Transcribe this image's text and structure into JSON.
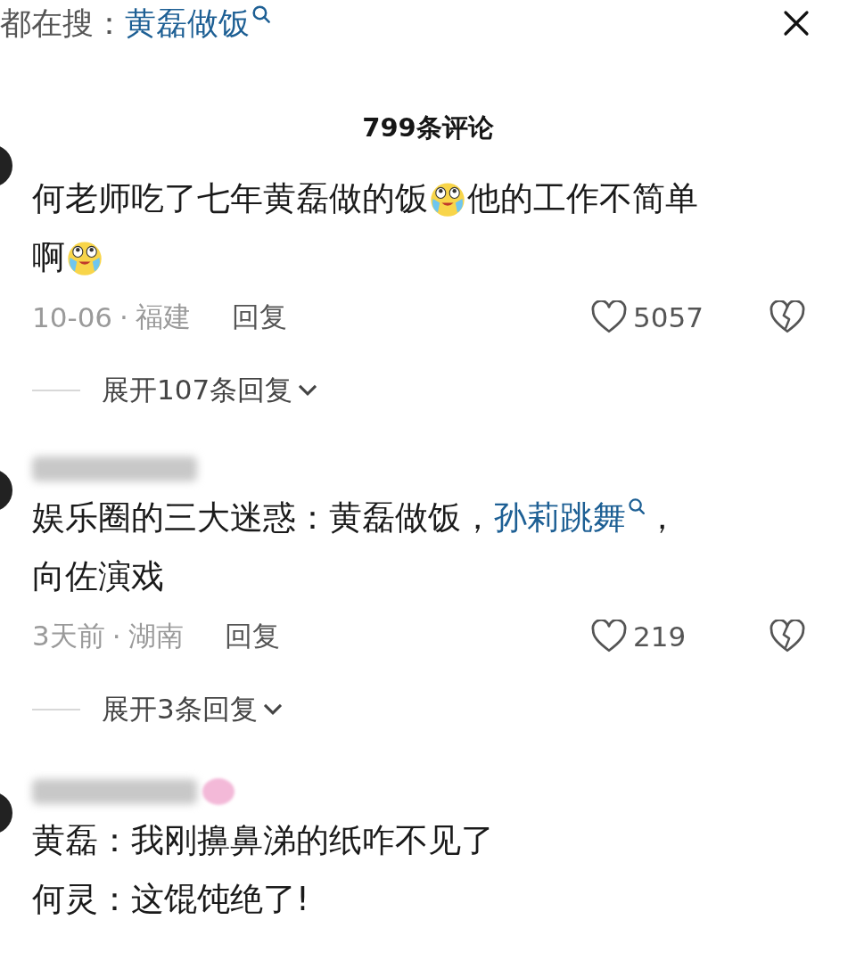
{
  "search_bar": {
    "label": "都在搜：",
    "query": "黄磊做饭"
  },
  "title": "799条评论",
  "comments": [
    {
      "lines": [
        [
          {
            "kind": "text",
            "text": "何老师吃了七年黄磊做的饭"
          },
          {
            "kind": "emoji"
          },
          {
            "kind": "text",
            "text": "他的工作不简单"
          }
        ],
        [
          {
            "kind": "text",
            "text": "啊"
          },
          {
            "kind": "emoji"
          }
        ]
      ],
      "date": "10-06",
      "separator": "·",
      "location": "福建",
      "reply": "回复",
      "likes": "5057",
      "expand": "展开107条回复"
    },
    {
      "lines": [
        [
          {
            "kind": "text",
            "text": "娱乐圈的三大迷惑：黄磊做饭，"
          },
          {
            "kind": "link",
            "text": "孙莉跳舞"
          },
          {
            "kind": "text",
            "text": "，"
          }
        ],
        [
          {
            "kind": "text",
            "text": "向佐演戏"
          }
        ]
      ],
      "date": "3天前",
      "separator": "·",
      "location": "湖南",
      "reply": "回复",
      "likes": "219",
      "expand": "展开3条回复"
    },
    {
      "lines": [
        [
          {
            "kind": "text",
            "text": "黄磊：我刚擤鼻涕的纸咋不见了"
          }
        ],
        [
          {
            "kind": "text",
            "text": "何灵：这馄饨绝了!"
          }
        ]
      ]
    }
  ]
}
